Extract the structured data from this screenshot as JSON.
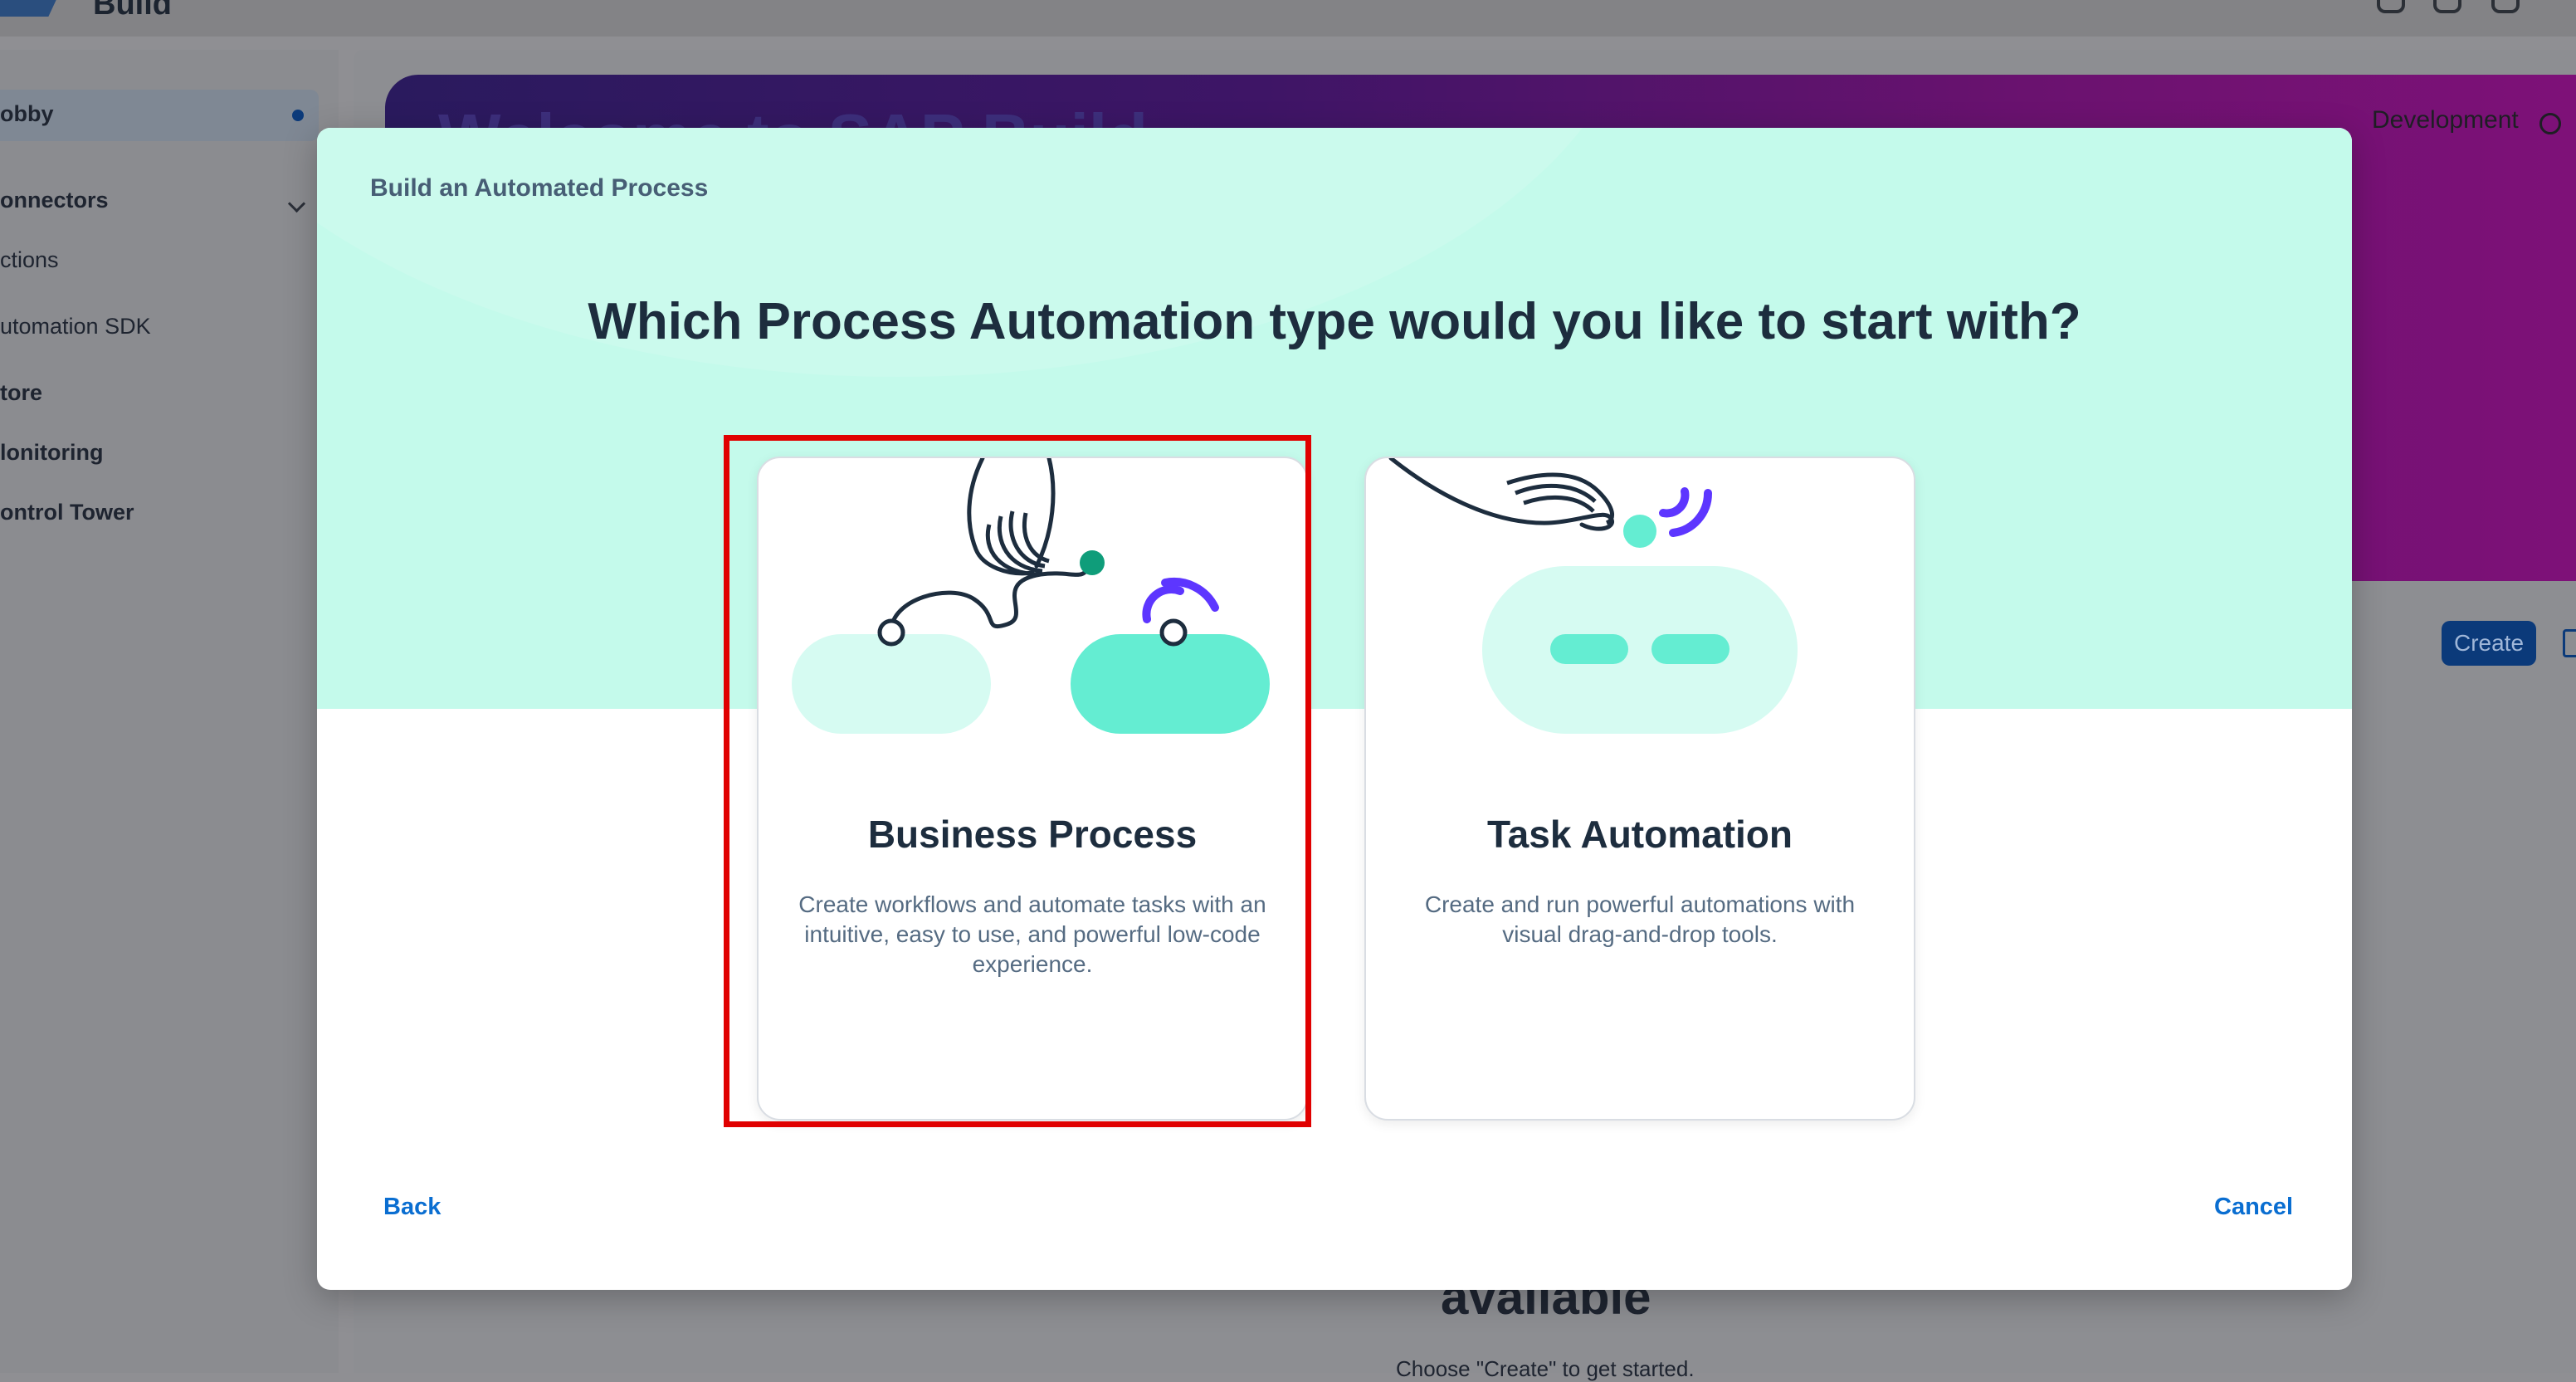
{
  "app": {
    "name": "Build"
  },
  "sidebar": {
    "items": [
      {
        "label": "obby"
      },
      {
        "label": "onnectors"
      },
      {
        "label": "ctions"
      },
      {
        "label": "utomation SDK"
      },
      {
        "label": "tore"
      },
      {
        "label": "lonitoring"
      },
      {
        "label": "ontrol Tower"
      }
    ]
  },
  "banner": {
    "title": "Welcome to SAP Build",
    "environment": "Development"
  },
  "toolbar": {
    "create_label": "Create"
  },
  "empty_state": {
    "title": "available",
    "subtitle": "Choose \"Create\" to get started."
  },
  "dialog": {
    "title": "Build an Automated Process",
    "question": "Which Process Automation type would you like to start with?",
    "cards": [
      {
        "title": "Business Process",
        "description": "Create workflows and automate tasks with an intuitive, easy to use, and powerful low-code experience.",
        "highlighted": true
      },
      {
        "title": "Task Automation",
        "description": "Create and run powerful automations with visual drag-and-drop tools.",
        "highlighted": false
      }
    ],
    "back_label": "Back",
    "cancel_label": "Cancel"
  },
  "colors": {
    "accent": "#0a6ed1",
    "hero": "#c4faeb",
    "teal": "#64edd2",
    "purple": "#5d36ff",
    "highlight": "#e00000"
  }
}
